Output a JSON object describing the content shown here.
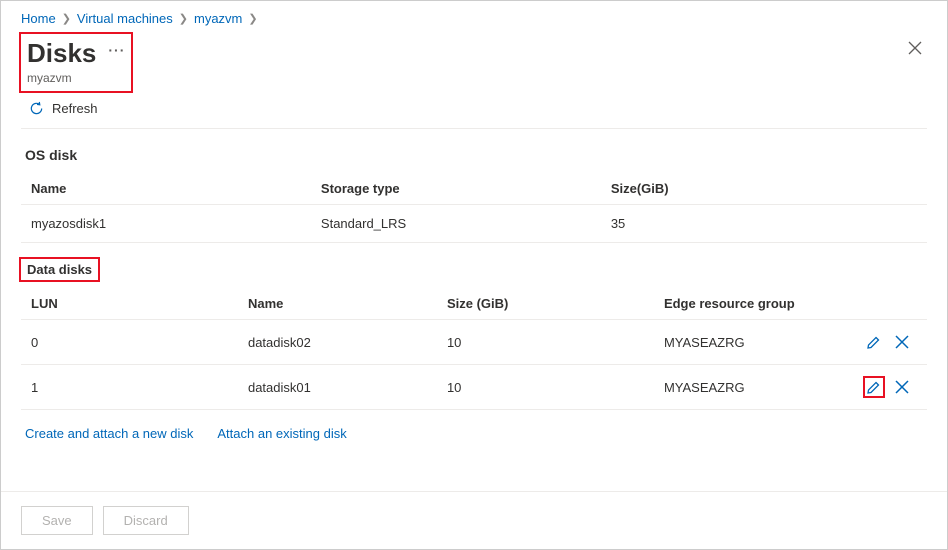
{
  "breadcrumb": [
    {
      "label": "Home"
    },
    {
      "label": "Virtual machines"
    },
    {
      "label": "myazvm"
    }
  ],
  "header": {
    "title": "Disks",
    "subtitle": "myazvm"
  },
  "toolbar": {
    "refresh_label": "Refresh"
  },
  "os_disk": {
    "section_title": "OS disk",
    "headers": {
      "name": "Name",
      "storage": "Storage type",
      "size": "Size(GiB)"
    },
    "row": {
      "name": "myazosdisk1",
      "storage": "Standard_LRS",
      "size": "35"
    }
  },
  "data_disks": {
    "section_title": "Data disks",
    "headers": {
      "lun": "LUN",
      "name": "Name",
      "size": "Size (GiB)",
      "erg": "Edge resource group"
    },
    "rows": [
      {
        "lun": "0",
        "name": "datadisk02",
        "size": "10",
        "erg": "MYASEAZRG"
      },
      {
        "lun": "1",
        "name": "datadisk01",
        "size": "10",
        "erg": "MYASEAZRG"
      }
    ]
  },
  "links": {
    "create": "Create and attach a new disk",
    "attach": "Attach an existing disk"
  },
  "footer": {
    "save": "Save",
    "discard": "Discard"
  }
}
